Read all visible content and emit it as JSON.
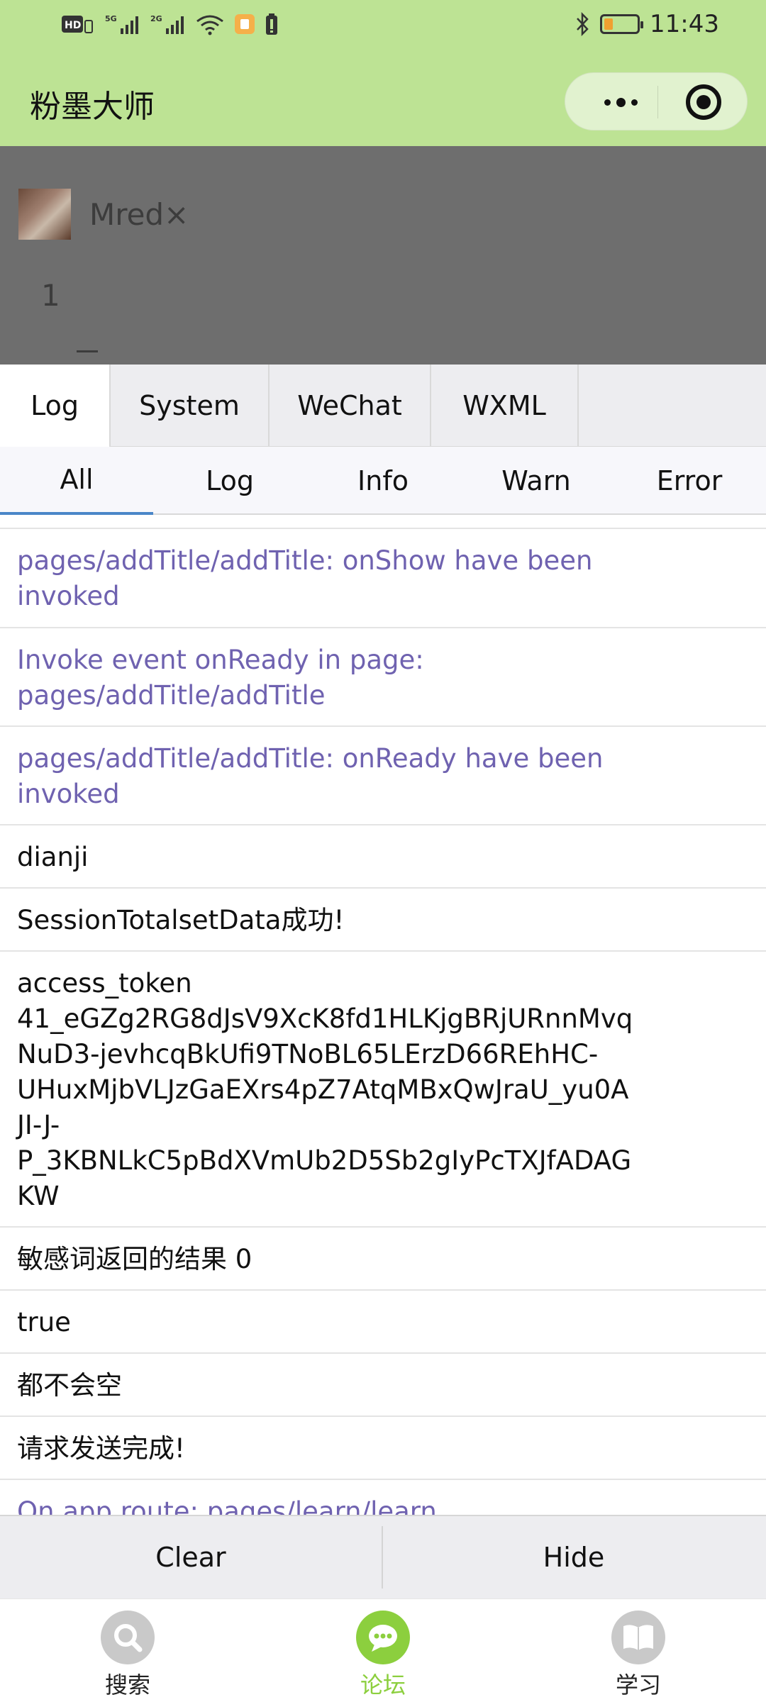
{
  "status_bar": {
    "left_icons": [
      "hd-icon",
      "signal-5g-icon",
      "signal-4g-icon",
      "wifi-icon",
      "notification-icon",
      "battery-saver-icon"
    ],
    "time": "11:43",
    "bluetooth_icon": "bluetooth-icon",
    "battery_level": 0.2
  },
  "header": {
    "title": "粉墨大师",
    "more_icon": "more-dots-icon",
    "close_icon": "target-close-icon"
  },
  "page": {
    "username": "Mred×",
    "number": "1"
  },
  "vconsole": {
    "tabs": [
      "Log",
      "System",
      "WeChat",
      "WXML"
    ],
    "subtabs": [
      "All",
      "Log",
      "Info",
      "Warn",
      "Error"
    ],
    "logs": [
      {
        "text": "pages/addTitle/addTitle: onShow have been\ninvoked",
        "type": "system"
      },
      {
        "text": "Invoke event onReady in page:\npages/addTitle/addTitle",
        "type": "system"
      },
      {
        "text": "pages/addTitle/addTitle: onReady have been\ninvoked",
        "type": "system"
      },
      {
        "text": "dianji",
        "type": "log"
      },
      {
        "text": "SessionTotalsetData成功!",
        "type": "log"
      },
      {
        "text": "access_token\n41_eGZg2RG8dJsV9XcK8fd1HLKjgBRjURnnMvq\nNuD3-jevhcqBkUfi9TNoBL65LErzD66REhHC-\nUHuxMjbVLJzGaEXrs4pZ7AtqMBxQwJraU_yu0A\nJI-J-\nP_3KBNLkC5pBdXVmUb2D5Sb2gIyPcTXJfADAG\nKW",
        "type": "log"
      },
      {
        "text": "敏感词返回的结果 0",
        "type": "log"
      },
      {
        "text": "true",
        "type": "log"
      },
      {
        "text": "都不会空",
        "type": "log"
      },
      {
        "text": "请求发送完成!",
        "type": "log"
      },
      {
        "text": "On app route: pages/learn/learn",
        "type": "system"
      }
    ],
    "clear_label": "Clear",
    "hide_label": "Hide"
  },
  "tabbar": {
    "items": [
      {
        "label": "搜索",
        "icon": "search-icon",
        "active": false
      },
      {
        "label": "论坛",
        "icon": "chat-icon",
        "active": true
      },
      {
        "label": "学习",
        "icon": "book-icon",
        "active": false
      }
    ],
    "active_color": "#8ccf3e",
    "inactive_color": "#c9c9c9"
  }
}
